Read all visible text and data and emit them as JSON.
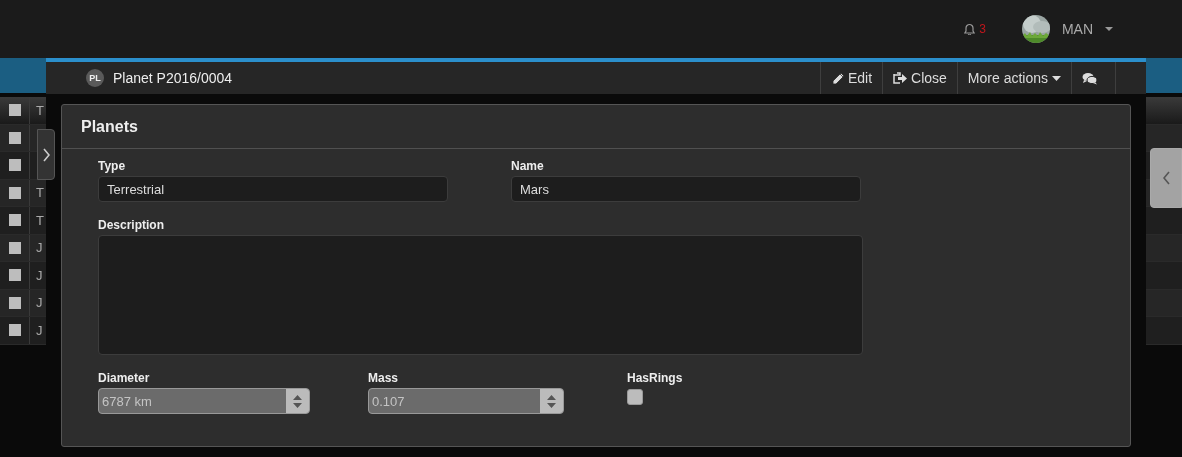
{
  "header": {
    "notifications": "3",
    "user": "MAN"
  },
  "background_list": {
    "rows": [
      {
        "text": "T",
        "checked": false
      },
      {
        "checked": false
      },
      {
        "checked": false
      },
      {
        "text": "T",
        "checked": false
      },
      {
        "text": "T",
        "checked": false
      },
      {
        "text": "J",
        "checked": false
      },
      {
        "text": "J",
        "checked": false
      },
      {
        "text": "J",
        "checked": false
      },
      {
        "text": "J",
        "checked": false
      }
    ]
  },
  "modal": {
    "badge": "PL",
    "title": "Planet P2016/0004",
    "actions": [
      {
        "kind": "edit",
        "label": "Edit"
      },
      {
        "kind": "close",
        "label": "Close"
      },
      {
        "kind": "menu",
        "label": "More actions"
      },
      {
        "kind": "chat"
      }
    ],
    "panel": {
      "title": "Planets",
      "fields": [
        {
          "kind": "text",
          "label": "Type",
          "value": "Terrestrial",
          "disabled": false
        },
        {
          "kind": "text",
          "label": "Name",
          "value": "Mars",
          "disabled": false
        },
        {
          "kind": "textarea",
          "label": "Description",
          "disabled": false
        },
        {
          "kind": "number",
          "label": "Diameter",
          "value": "6787 km",
          "disabled": true
        },
        {
          "kind": "number",
          "label": "Mass",
          "value": "0.107",
          "disabled": true
        },
        {
          "kind": "checkbox",
          "label": "HasRings",
          "checked": false
        }
      ]
    }
  }
}
